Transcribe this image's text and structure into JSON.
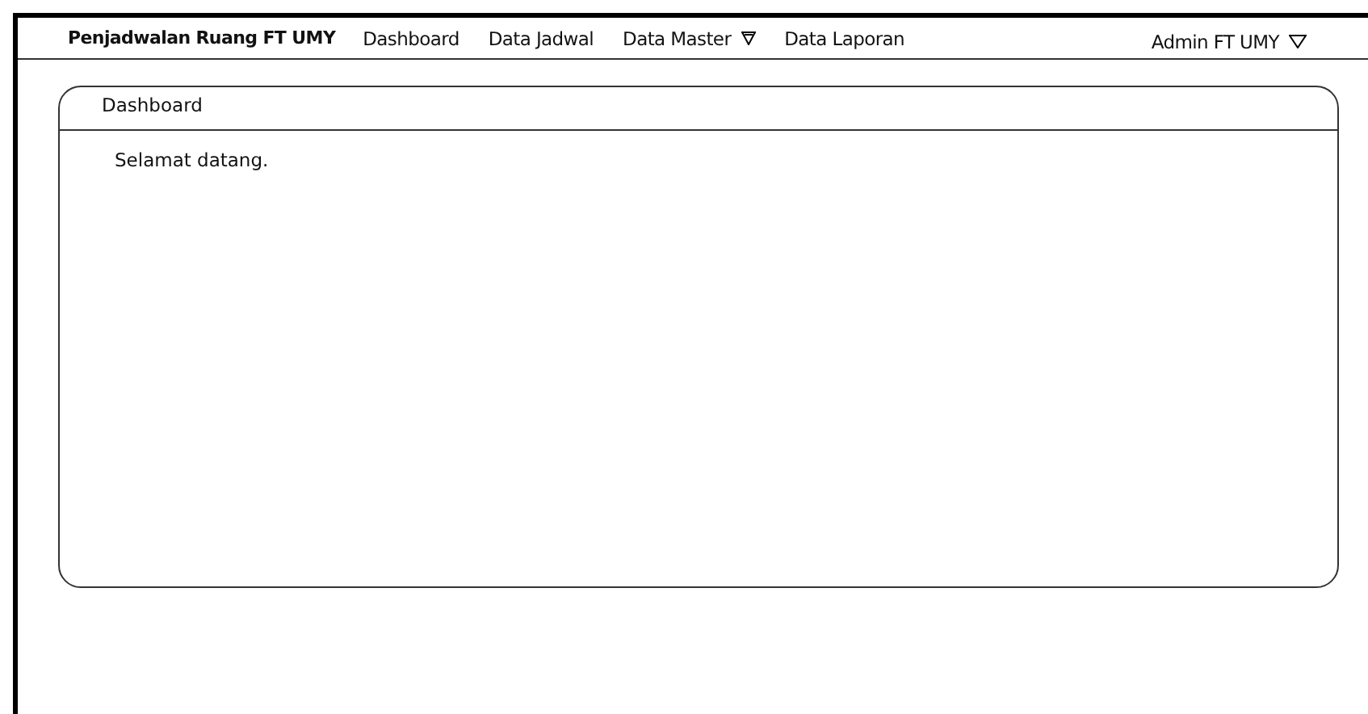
{
  "navbar": {
    "brand": "Penjadwalan Ruang FT UMY",
    "menu": [
      {
        "label": "Dashboard",
        "has_menu": false
      },
      {
        "label": "Data Jadwal",
        "has_menu": false
      },
      {
        "label": "Data Master",
        "has_menu": true
      },
      {
        "label": "Data Laporan",
        "has_menu": false
      }
    ],
    "user": {
      "label": "Admin FT UMY",
      "has_menu": true
    }
  },
  "panel": {
    "title": "Dashboard",
    "message": "Selamat datang."
  }
}
